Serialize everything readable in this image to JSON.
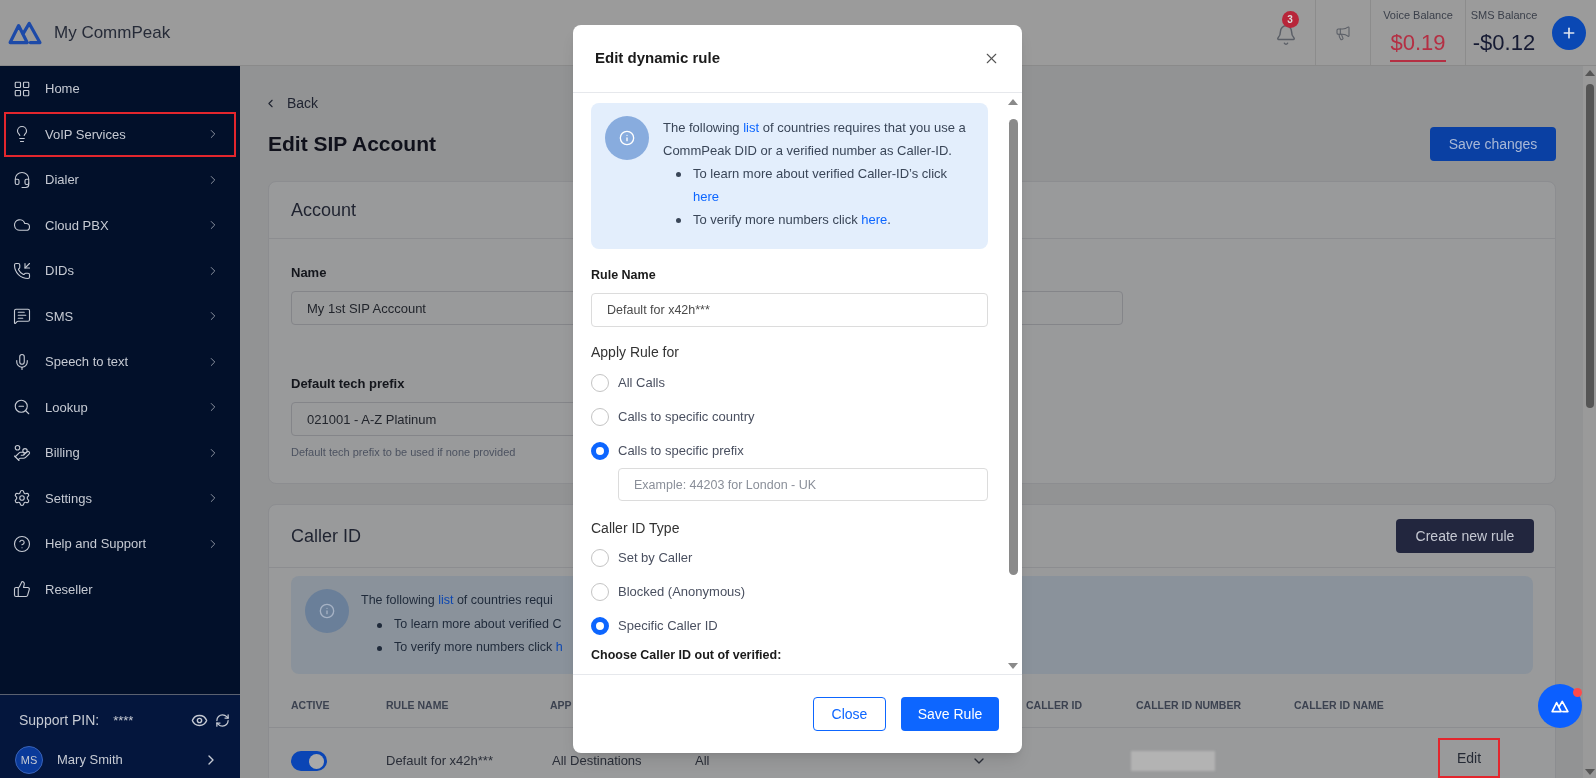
{
  "header": {
    "brand": "My CommPeak",
    "notification_count": "3",
    "balances": [
      {
        "label": "Voice Balance",
        "value": "$0.19",
        "color": "#b42f43",
        "selected": true
      },
      {
        "label": "SMS Balance",
        "value": "-$0.12",
        "color": "#161b33",
        "selected": false
      }
    ]
  },
  "sidebar": {
    "items": [
      {
        "label": "Home",
        "has_submenu": false,
        "highlighted": false
      },
      {
        "label": "VoIP Services",
        "has_submenu": true,
        "highlighted": true
      },
      {
        "label": "Dialer",
        "has_submenu": true,
        "highlighted": false
      },
      {
        "label": "Cloud PBX",
        "has_submenu": true,
        "highlighted": false
      },
      {
        "label": "DIDs",
        "has_submenu": true,
        "highlighted": false
      },
      {
        "label": "SMS",
        "has_submenu": true,
        "highlighted": false
      },
      {
        "label": "Speech to text",
        "has_submenu": true,
        "highlighted": false
      },
      {
        "label": "Lookup",
        "has_submenu": true,
        "highlighted": false
      },
      {
        "label": "Billing",
        "has_submenu": true,
        "highlighted": false
      },
      {
        "label": "Settings",
        "has_submenu": true,
        "highlighted": false
      },
      {
        "label": "Help and Support",
        "has_submenu": true,
        "highlighted": false
      },
      {
        "label": "Reseller",
        "has_submenu": false,
        "highlighted": false
      }
    ],
    "support_pin": {
      "label": "Support PIN:",
      "value": "****"
    },
    "user": {
      "initials": "MS",
      "name": "Mary Smith"
    }
  },
  "page": {
    "back": "Back",
    "title": "Edit SIP Account",
    "save_button": "Save changes",
    "account": {
      "title": "Account",
      "fields": [
        {
          "label": "Name",
          "value": "My 1st SIP Acccount"
        },
        {
          "label": "Default tech prefix",
          "value": "021001 - A-Z Platinum",
          "hint": "Default tech prefix to be used if none provided"
        }
      ]
    },
    "caller_id": {
      "title": "Caller ID",
      "create_button": "Create new rule",
      "notice": {
        "before": "The following ",
        "link": "list",
        "after": " of countries requi",
        "bullets": [
          {
            "text": "To learn more about verified C"
          },
          {
            "text": "To verify more numbers click ",
            "link": "h"
          }
        ]
      },
      "table": {
        "columns": [
          "ACTIVE",
          "RULE NAME",
          "APP",
          "CALLER ID",
          "CALLER ID NUMBER",
          "CALLER ID NAME"
        ],
        "rows": [
          {
            "active": true,
            "rule_name": "Default for x42h***",
            "column_3": "All Destinations",
            "column_4": "All",
            "number_blurred": true,
            "action": "Edit",
            "action_highlighted": true
          }
        ]
      }
    }
  },
  "modal": {
    "title": "Edit dynamic rule",
    "notice": {
      "before": "The following ",
      "link": "list",
      "after": " of countries requires that you use a CommPeak DID or a verified number as Caller-ID.",
      "bullets": [
        {
          "text": "To learn more about verified Caller-ID’s click ",
          "link": "here"
        },
        {
          "text": "To verify more numbers click ",
          "link": "here",
          "after": "."
        }
      ]
    },
    "rule_name": {
      "label": "Rule Name",
      "value": "Default for x42h***"
    },
    "apply_rule": {
      "label": "Apply Rule for",
      "options": [
        {
          "label": "All Calls",
          "selected": false
        },
        {
          "label": "Calls to specific country",
          "selected": false
        },
        {
          "label": "Calls to specific prefix",
          "selected": true,
          "placeholder": "Example: 44203 for London - UK"
        }
      ]
    },
    "caller_id_type": {
      "label": "Caller ID Type",
      "options": [
        {
          "label": "Set by Caller",
          "selected": false
        },
        {
          "label": "Blocked (Anonymous)",
          "selected": false
        },
        {
          "label": "Specific Caller ID",
          "selected": true
        }
      ],
      "choose_label": "Choose Caller ID out of verified:"
    },
    "buttons": [
      {
        "label": "Close",
        "kind": "secondary"
      },
      {
        "label": "Save Rule",
        "kind": "primary"
      }
    ]
  },
  "chat_widget": {
    "unread": true
  }
}
